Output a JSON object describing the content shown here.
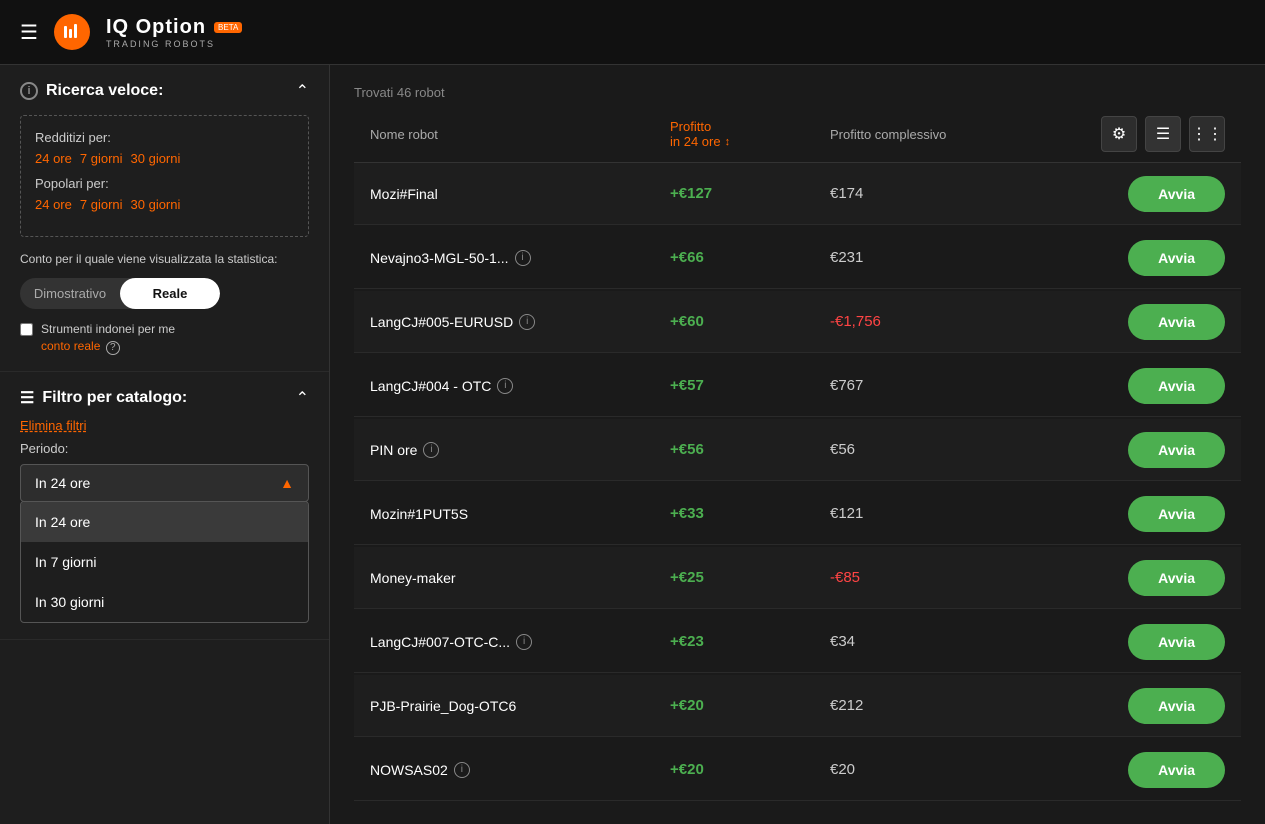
{
  "app": {
    "title": "IQ Option",
    "subtitle": "TRADING ROBOTS",
    "beta": "BETA"
  },
  "sidebar": {
    "quick_search_title": "Ricerca veloce:",
    "profitable_label": "Redditizi per:",
    "profitable_links": [
      "24 ore",
      "7 giorni",
      "30 giorni"
    ],
    "popular_label": "Popolari per:",
    "popular_links": [
      "24 ore",
      "7 giorni",
      "30 giorni"
    ],
    "account_text": "Conto per il quale viene visualizzata la statistica:",
    "toggle_demo": "Dimostrativo",
    "toggle_real": "Reale",
    "checkbox_label": "Strumenti indonei per me",
    "real_account_link": "conto reale",
    "filter_title": "Filtro per catalogo:",
    "clear_filters": "Elimina filtri",
    "period_label": "Periodo:",
    "dropdown_selected": "In 24 ore",
    "dropdown_options": [
      "In 24 ore",
      "In 7 giorni",
      "In 30 giorni"
    ]
  },
  "table": {
    "found_label": "Trovati 46 robot",
    "col_name": "Nome robot",
    "col_profit24": "Profitto",
    "col_profit24_sub": "in 24 ore",
    "col_profit_total": "Profitto complessivo",
    "avvia_label": "Avvia",
    "robots": [
      {
        "name": "Mozi#Final",
        "has_info": false,
        "profit24": "+€127",
        "profit_total": "€174",
        "total_negative": false
      },
      {
        "name": "Nevajno3-MGL-50-1...",
        "has_info": true,
        "profit24": "+€66",
        "profit_total": "€231",
        "total_negative": false
      },
      {
        "name": "LangCJ#005-EURUSD",
        "has_info": true,
        "profit24": "+€60",
        "profit_total": "-€1,756",
        "total_negative": true
      },
      {
        "name": "LangCJ#004 - OTC",
        "has_info": true,
        "profit24": "+€57",
        "profit_total": "€767",
        "total_negative": false
      },
      {
        "name": "PIN ore",
        "has_info": true,
        "profit24": "+€56",
        "profit_total": "€56",
        "total_negative": false
      },
      {
        "name": "Mozin#1PUT5S",
        "has_info": false,
        "profit24": "+€33",
        "profit_total": "€121",
        "total_negative": false
      },
      {
        "name": "Money-maker",
        "has_info": false,
        "profit24": "+€25",
        "profit_total": "-€85",
        "total_negative": true
      },
      {
        "name": "LangCJ#007-OTC-C...",
        "has_info": true,
        "profit24": "+€23",
        "profit_total": "€34",
        "total_negative": false
      },
      {
        "name": "PJB-Prairie_Dog-OTC6",
        "has_info": false,
        "profit24": "+€20",
        "profit_total": "€212",
        "total_negative": false
      },
      {
        "name": "NOWSAS02",
        "has_info": true,
        "profit24": "+€20",
        "profit_total": "€20",
        "total_negative": false
      }
    ]
  }
}
